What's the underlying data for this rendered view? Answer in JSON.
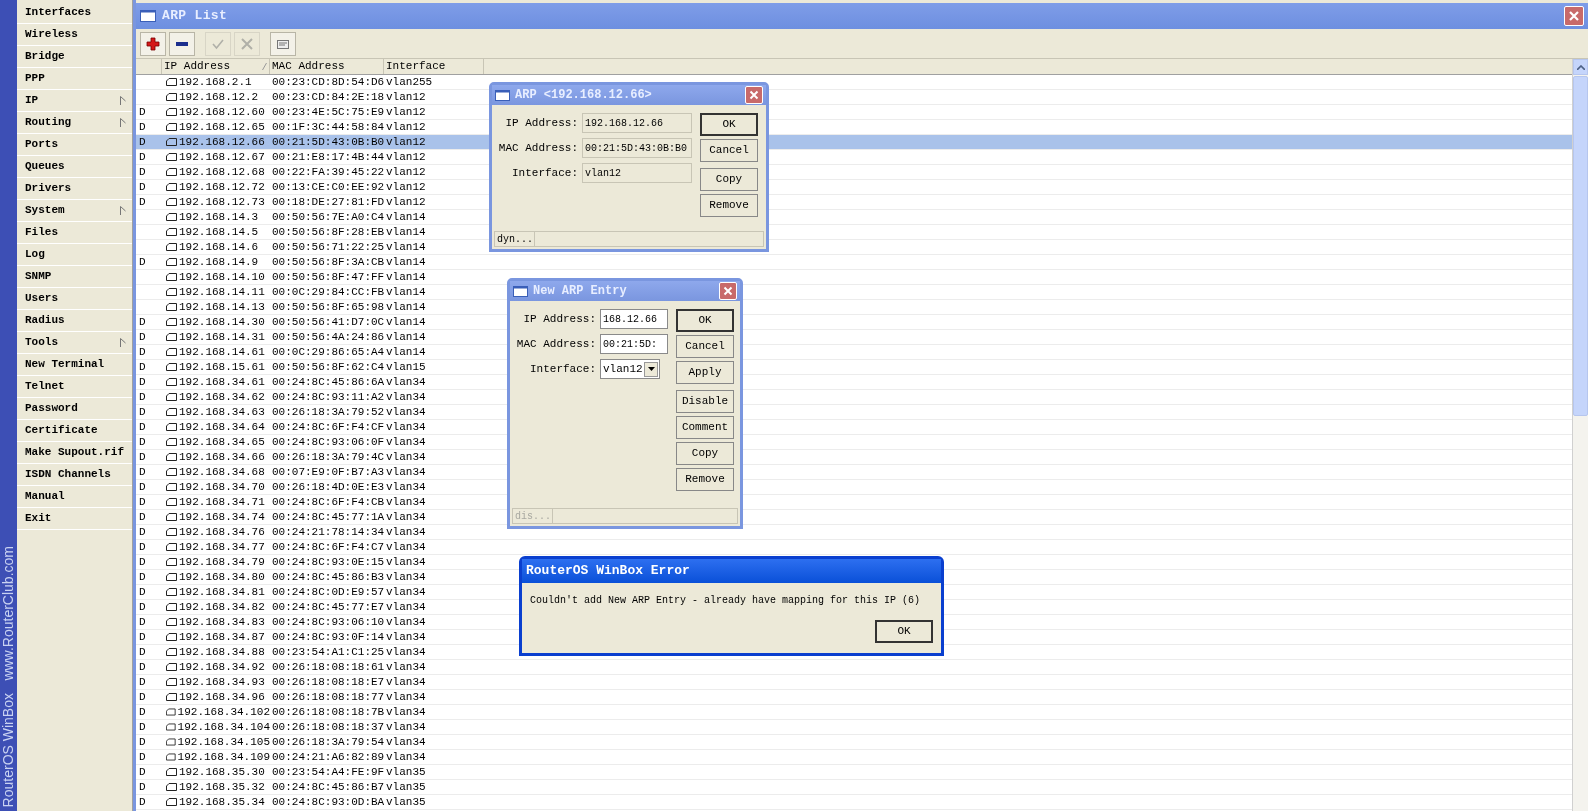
{
  "brand": {
    "product": "RouterOS WinBox",
    "site": "www.RouterClub.com"
  },
  "menu": [
    {
      "label": "Interfaces",
      "has_submenu": false
    },
    {
      "label": "Wireless",
      "has_submenu": false
    },
    {
      "label": "Bridge",
      "has_submenu": false
    },
    {
      "label": "PPP",
      "has_submenu": false
    },
    {
      "label": "IP",
      "has_submenu": true
    },
    {
      "label": "Routing",
      "has_submenu": true
    },
    {
      "label": "Ports",
      "has_submenu": false
    },
    {
      "label": "Queues",
      "has_submenu": false
    },
    {
      "label": "Drivers",
      "has_submenu": false
    },
    {
      "label": "System",
      "has_submenu": true
    },
    {
      "label": "Files",
      "has_submenu": false
    },
    {
      "label": "Log",
      "has_submenu": false
    },
    {
      "label": "SNMP",
      "has_submenu": false
    },
    {
      "label": "Users",
      "has_submenu": false
    },
    {
      "label": "Radius",
      "has_submenu": false
    },
    {
      "label": "Tools",
      "has_submenu": true
    },
    {
      "label": "New Terminal",
      "has_submenu": false
    },
    {
      "label": "Telnet",
      "has_submenu": false
    },
    {
      "label": "Password",
      "has_submenu": false
    },
    {
      "label": "Certificate",
      "has_submenu": false
    },
    {
      "label": "Make Supout.rif",
      "has_submenu": false
    },
    {
      "label": "ISDN Channels",
      "has_submenu": false
    },
    {
      "label": "Manual",
      "has_submenu": false
    },
    {
      "label": "Exit",
      "has_submenu": false
    }
  ],
  "window": {
    "title": "ARP List"
  },
  "toolbar": [
    {
      "kind": "add",
      "disabled": false
    },
    {
      "kind": "remove",
      "disabled": false
    },
    {
      "kind": "enable",
      "disabled": true
    },
    {
      "kind": "disable",
      "disabled": true
    },
    {
      "kind": "comment",
      "disabled": false
    }
  ],
  "table": {
    "columns": [
      "IP Address",
      "MAC Address",
      "Interface"
    ],
    "rows": [
      {
        "ip": "192.168.2.1",
        "mac": "00:23:CD:8D:54:D6",
        "interface": "vlan255",
        "selected": false
      },
      {
        "ip": "192.168.12.2",
        "mac": "00:23:CD:84:2E:18",
        "interface": "vlan12",
        "selected": false
      },
      {
        "flag": "D",
        "ip": "192.168.12.60",
        "mac": "00:23:4E:5C:75:E9",
        "interface": "vlan12",
        "selected": false
      },
      {
        "flag": "D",
        "ip": "192.168.12.65",
        "mac": "00:1F:3C:44:58:84",
        "interface": "vlan12",
        "selected": false
      },
      {
        "flag": "D",
        "ip": "192.168.12.66",
        "mac": "00:21:5D:43:0B:B0",
        "interface": "vlan12",
        "selected": true
      },
      {
        "flag": "D",
        "ip": "192.168.12.67",
        "mac": "00:21:E8:17:4B:44",
        "interface": "vlan12",
        "selected": false
      },
      {
        "flag": "D",
        "ip": "192.168.12.68",
        "mac": "00:22:FA:39:45:22",
        "interface": "vlan12",
        "selected": false
      },
      {
        "flag": "D",
        "ip": "192.168.12.72",
        "mac": "00:13:CE:C0:EE:92",
        "interface": "vlan12",
        "selected": false
      },
      {
        "flag": "D",
        "ip": "192.168.12.73",
        "mac": "00:18:DE:27:81:FD",
        "interface": "vlan12",
        "selected": false
      },
      {
        "ip": "192.168.14.3",
        "mac": "00:50:56:7E:A0:C4",
        "interface": "vlan14",
        "selected": false
      },
      {
        "ip": "192.168.14.5",
        "mac": "00:50:56:8F:28:EB",
        "interface": "vlan14",
        "selected": false
      },
      {
        "ip": "192.168.14.6",
        "mac": "00:50:56:71:22:25",
        "interface": "vlan14",
        "selected": false
      },
      {
        "flag": "D",
        "ip": "192.168.14.9",
        "mac": "00:50:56:8F:3A:CB",
        "interface": "vlan14",
        "selected": false
      },
      {
        "ip": "192.168.14.10",
        "mac": "00:50:56:8F:47:FF",
        "interface": "vlan14",
        "selected": false
      },
      {
        "ip": "192.168.14.11",
        "mac": "00:0C:29:84:CC:FB",
        "interface": "vlan14",
        "selected": false
      },
      {
        "ip": "192.168.14.13",
        "mac": "00:50:56:8F:65:98",
        "interface": "vlan14",
        "selected": false
      },
      {
        "flag": "D",
        "ip": "192.168.14.30",
        "mac": "00:50:56:41:D7:0C",
        "interface": "vlan14",
        "selected": false
      },
      {
        "flag": "D",
        "ip": "192.168.14.31",
        "mac": "00:50:56:4A:24:86",
        "interface": "vlan14",
        "selected": false
      },
      {
        "flag": "D",
        "ip": "192.168.14.61",
        "mac": "00:0C:29:86:65:A4",
        "interface": "vlan14",
        "selected": false
      },
      {
        "flag": "D",
        "ip": "192.168.15.61",
        "mac": "00:50:56:8F:62:C4",
        "interface": "vlan15",
        "selected": false
      },
      {
        "flag": "D",
        "ip": "192.168.34.61",
        "mac": "00:24:8C:45:86:6A",
        "interface": "vlan34",
        "selected": false
      },
      {
        "flag": "D",
        "ip": "192.168.34.62",
        "mac": "00:24:8C:93:11:A2",
        "interface": "vlan34",
        "selected": false
      },
      {
        "flag": "D",
        "ip": "192.168.34.63",
        "mac": "00:26:18:3A:79:52",
        "interface": "vlan34",
        "selected": false
      },
      {
        "flag": "D",
        "ip": "192.168.34.64",
        "mac": "00:24:8C:6F:F4:CF",
        "interface": "vlan34",
        "selected": false
      },
      {
        "flag": "D",
        "ip": "192.168.34.65",
        "mac": "00:24:8C:93:06:0F",
        "interface": "vlan34",
        "selected": false
      },
      {
        "flag": "D",
        "ip": "192.168.34.66",
        "mac": "00:26:18:3A:79:4C",
        "interface": "vlan34",
        "selected": false
      },
      {
        "flag": "D",
        "ip": "192.168.34.68",
        "mac": "00:07:E9:0F:B7:A3",
        "interface": "vlan34",
        "selected": false
      },
      {
        "flag": "D",
        "ip": "192.168.34.70",
        "mac": "00:26:18:4D:0E:E3",
        "interface": "vlan34",
        "selected": false
      },
      {
        "flag": "D",
        "ip": "192.168.34.71",
        "mac": "00:24:8C:6F:F4:CB",
        "interface": "vlan34",
        "selected": false
      },
      {
        "flag": "D",
        "ip": "192.168.34.74",
        "mac": "00:24:8C:45:77:1A",
        "interface": "vlan34",
        "selected": false
      },
      {
        "flag": "D",
        "ip": "192.168.34.76",
        "mac": "00:24:21:78:14:34",
        "interface": "vlan34",
        "selected": false
      },
      {
        "flag": "D",
        "ip": "192.168.34.77",
        "mac": "00:24:8C:6F:F4:C7",
        "interface": "vlan34",
        "selected": false
      },
      {
        "flag": "D",
        "ip": "192.168.34.79",
        "mac": "00:24:8C:93:0E:15",
        "interface": "vlan34",
        "selected": false
      },
      {
        "flag": "D",
        "ip": "192.168.34.80",
        "mac": "00:24:8C:45:86:B3",
        "interface": "vlan34",
        "selected": false
      },
      {
        "flag": "D",
        "ip": "192.168.34.81",
        "mac": "00:24:8C:0D:E9:57",
        "interface": "vlan34",
        "selected": false
      },
      {
        "flag": "D",
        "ip": "192.168.34.82",
        "mac": "00:24:8C:45:77:E7",
        "interface": "vlan34",
        "selected": false
      },
      {
        "flag": "D",
        "ip": "192.168.34.83",
        "mac": "00:24:8C:93:06:10",
        "interface": "vlan34",
        "selected": false
      },
      {
        "flag": "D",
        "ip": "192.168.34.87",
        "mac": "00:24:8C:93:0F:14",
        "interface": "vlan34",
        "selected": false
      },
      {
        "flag": "D",
        "ip": "192.168.34.88",
        "mac": "00:23:54:A1:C1:25",
        "interface": "vlan34",
        "selected": false
      },
      {
        "flag": "D",
        "ip": "192.168.34.92",
        "mac": "00:26:18:08:18:61",
        "interface": "vlan34",
        "selected": false
      },
      {
        "flag": "D",
        "ip": "192.168.34.93",
        "mac": "00:26:18:08:18:E7",
        "interface": "vlan34",
        "selected": false
      },
      {
        "flag": "D",
        "ip": "192.168.34.96",
        "mac": "00:26:18:08:18:77",
        "interface": "vlan34",
        "selected": false
      },
      {
        "flag": "D",
        "ip": "192.168.34.102",
        "mac": "00:26:18:08:18:7B",
        "interface": "vlan34",
        "selected": false
      },
      {
        "flag": "D",
        "ip": "192.168.34.104",
        "mac": "00:26:18:08:18:37",
        "interface": "vlan34",
        "selected": false
      },
      {
        "flag": "D",
        "ip": "192.168.34.105",
        "mac": "00:26:18:3A:79:54",
        "interface": "vlan34",
        "selected": false
      },
      {
        "flag": "D",
        "ip": "192.168.34.109",
        "mac": "00:24:21:A6:82:89",
        "interface": "vlan34",
        "selected": false
      },
      {
        "flag": "D",
        "ip": "192.168.35.30",
        "mac": "00:23:54:A4:FE:9F",
        "interface": "vlan35",
        "selected": false
      },
      {
        "flag": "D",
        "ip": "192.168.35.32",
        "mac": "00:24:8C:45:86:B7",
        "interface": "vlan35",
        "selected": false
      },
      {
        "flag": "D",
        "ip": "192.168.35.34",
        "mac": "00:24:8C:93:0D:BA",
        "interface": "vlan35",
        "selected": false
      }
    ]
  },
  "arp_dialog": {
    "title": "ARP <192.168.12.66>",
    "fields": [
      {
        "label": "IP Address:",
        "value": "192.168.12.66"
      },
      {
        "label": "MAC Address:",
        "value": "00:21:5D:43:0B:B0"
      },
      {
        "label": "Interface:",
        "value": "vlan12"
      }
    ],
    "button_groups": [
      [
        {
          "label": "OK",
          "default": true
        },
        {
          "label": "Cancel",
          "default": false
        }
      ],
      [
        {
          "label": "Copy",
          "default": false
        },
        {
          "label": "Remove",
          "default": false
        }
      ]
    ],
    "status": {
      "text": "dyn...",
      "disabled": false
    }
  },
  "new_arp_dialog": {
    "title": "New ARP Entry",
    "fields": [
      {
        "kind": "text",
        "label": "IP Address:",
        "value": "168.12.66"
      },
      {
        "kind": "text",
        "label": "MAC Address:",
        "value": "00:21:5D:"
      },
      {
        "kind": "dropdown",
        "label": "Interface:",
        "value": "vlan12"
      }
    ],
    "button_groups": [
      [
        {
          "label": "OK",
          "default": true
        },
        {
          "label": "Cancel",
          "default": false
        },
        {
          "label": "Apply",
          "default": false
        }
      ],
      [
        {
          "label": "Disable",
          "default": false
        },
        {
          "label": "Comment",
          "default": false
        },
        {
          "label": "Copy",
          "default": false
        },
        {
          "label": "Remove",
          "default": false
        }
      ]
    ],
    "status": {
      "text": "dis...",
      "disabled": true
    }
  },
  "error_dialog": {
    "title": "RouterOS WinBox Error",
    "message": "Couldn't add New ARP Entry - already have mapping for this IP (6)",
    "button": "OK"
  }
}
